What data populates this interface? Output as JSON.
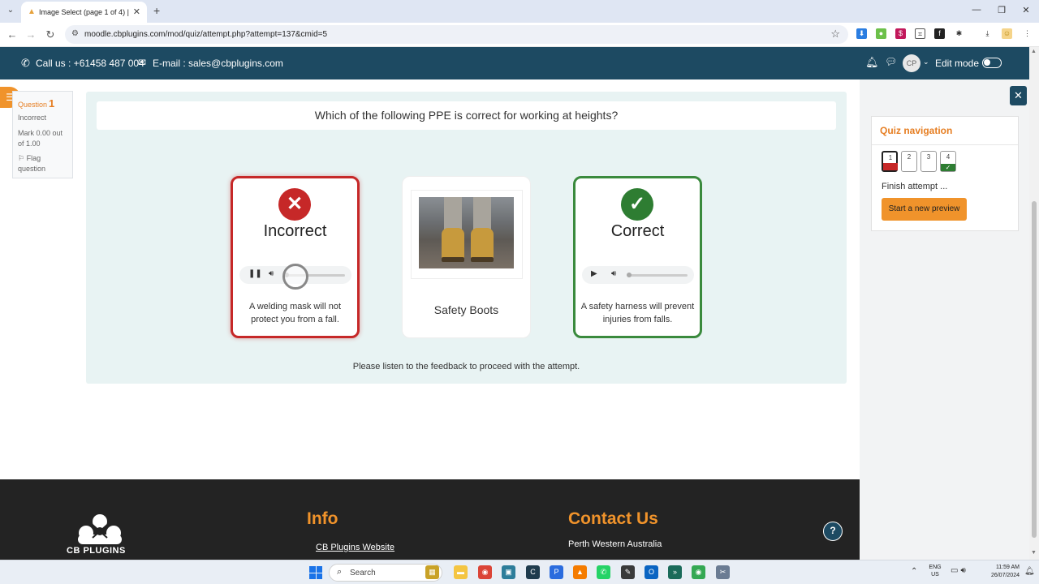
{
  "browser": {
    "tab_title": "Image Select (page 1 of 4) | cb",
    "url": "moodle.cbplugins.com/mod/quiz/attempt.php?attempt=137&cmid=5"
  },
  "header": {
    "phone": "Call us : +61458 487 004",
    "email": "E-mail : sales@cbplugins.com",
    "avatar_initials": "CP",
    "edit_mode_label": "Edit mode"
  },
  "question_info": {
    "label": "Question",
    "number": "1",
    "state": "Incorrect",
    "mark": "Mark 0.00 out of 1.00",
    "flag": "Flag question"
  },
  "question": {
    "text": "Which of the following PPE is correct for working at heights?",
    "cards": [
      {
        "status": "Incorrect",
        "feedback": "A welding mask will not protect you from a fall.",
        "audio_state": "playing"
      },
      {
        "label": "Safety Boots",
        "image": "safety-boots-photo"
      },
      {
        "status": "Correct",
        "feedback": "A safety harness will prevent injuries from falls.",
        "audio_state": "paused"
      }
    ],
    "proceed_note": "Please listen to the feedback to proceed with the attempt."
  },
  "quiz_navigation": {
    "title": "Quiz navigation",
    "buttons": [
      {
        "num": "1",
        "state": "incorrect",
        "current": true
      },
      {
        "num": "2",
        "state": "unanswered"
      },
      {
        "num": "3",
        "state": "unanswered"
      },
      {
        "num": "4",
        "state": "correct"
      }
    ],
    "finish": "Finish attempt ...",
    "new_preview": "Start a new preview"
  },
  "footer": {
    "logo_text": "CB PLUGINS",
    "info_title": "Info",
    "info_link": "CB Plugins Website",
    "contact_title": "Contact Us",
    "contact_location": "Perth Western Australia"
  },
  "taskbar": {
    "search_placeholder": "Search",
    "lang_line1": "ENG",
    "lang_line2": "US",
    "time": "11:59 AM",
    "date": "26/07/2024"
  },
  "colors": {
    "header_bg": "#1d4a62",
    "accent_orange": "#f0932b",
    "incorrect_red": "#c62828",
    "correct_green": "#2e7d32"
  }
}
